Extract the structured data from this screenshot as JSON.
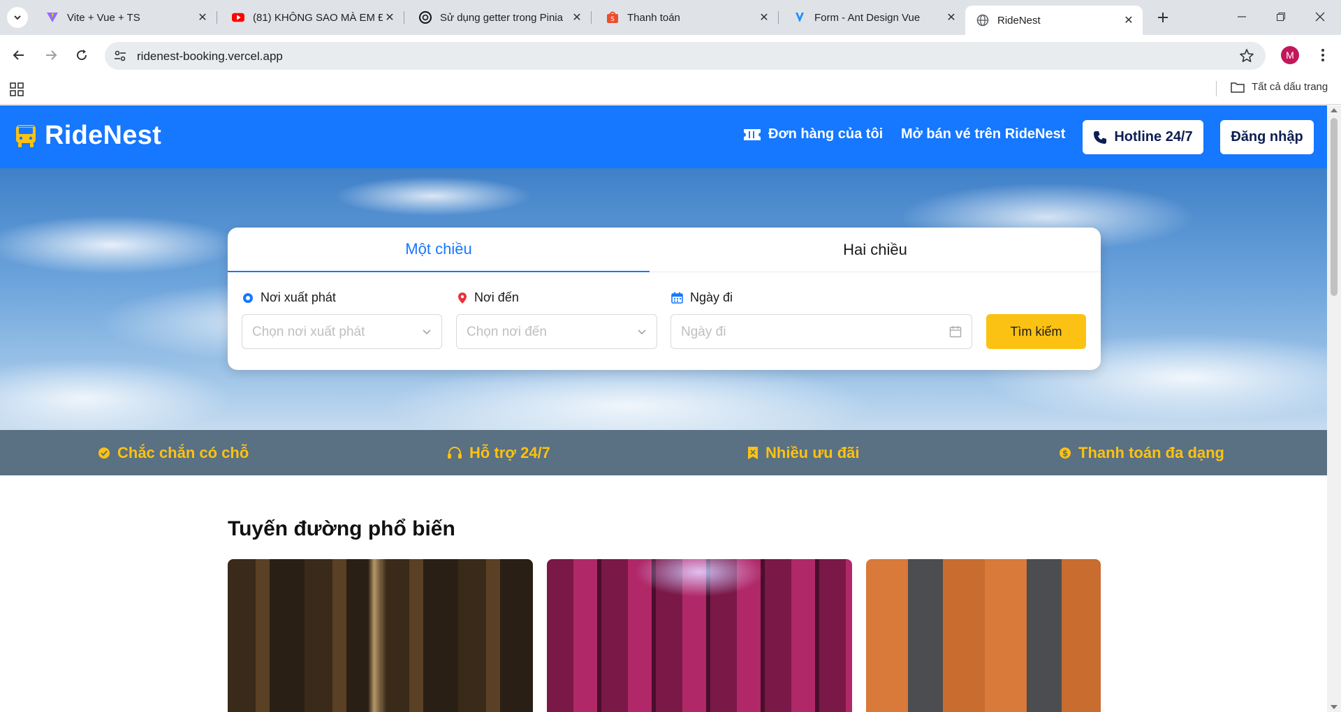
{
  "browser": {
    "tabs": [
      {
        "title": "Vite + Vue + TS",
        "icon": "vite-icon"
      },
      {
        "title": "(81) KHÔNG SAO MÀ EM Đ",
        "icon": "youtube-icon"
      },
      {
        "title": "Sử dụng getter trong Pinia",
        "icon": "openai-icon"
      },
      {
        "title": "Thanh toán",
        "icon": "shopee-icon"
      },
      {
        "title": "Form - Ant Design Vue",
        "icon": "antdv-icon"
      },
      {
        "title": "RideNest",
        "icon": "globe-icon"
      }
    ],
    "url": "ridenest-booking.vercel.app",
    "profile_initial": "M",
    "all_bookmarks": "Tất cả dấu trang"
  },
  "header": {
    "logo": "RideNest",
    "nav_orders": "Đơn hàng của tôi",
    "nav_sell": "Mở bán vé trên RideNest",
    "hotline": "Hotline 24/7",
    "login": "Đăng nhập"
  },
  "search": {
    "tabs": [
      "Một chiều",
      "Hai chiều"
    ],
    "active_tab": "Một chiều",
    "origin_label": "Nơi xuất phát",
    "origin_placeholder": "Chọn nơi xuất phát",
    "destination_label": "Nơi đến",
    "destination_placeholder": "Chọn nơi đến",
    "date_label": "Ngày đi",
    "date_placeholder": "Ngày đi",
    "submit": "Tìm kiếm"
  },
  "features": [
    "Chắc chắn có chỗ",
    "Hỗ trợ 24/7",
    "Nhiều ưu đãi",
    "Thanh toán đa dạng"
  ],
  "popular": {
    "title": "Tuyến đường phổ biến"
  },
  "colors": {
    "primary": "#1677ff",
    "accent": "#fbc213",
    "feature_bar": "#5a7083"
  }
}
